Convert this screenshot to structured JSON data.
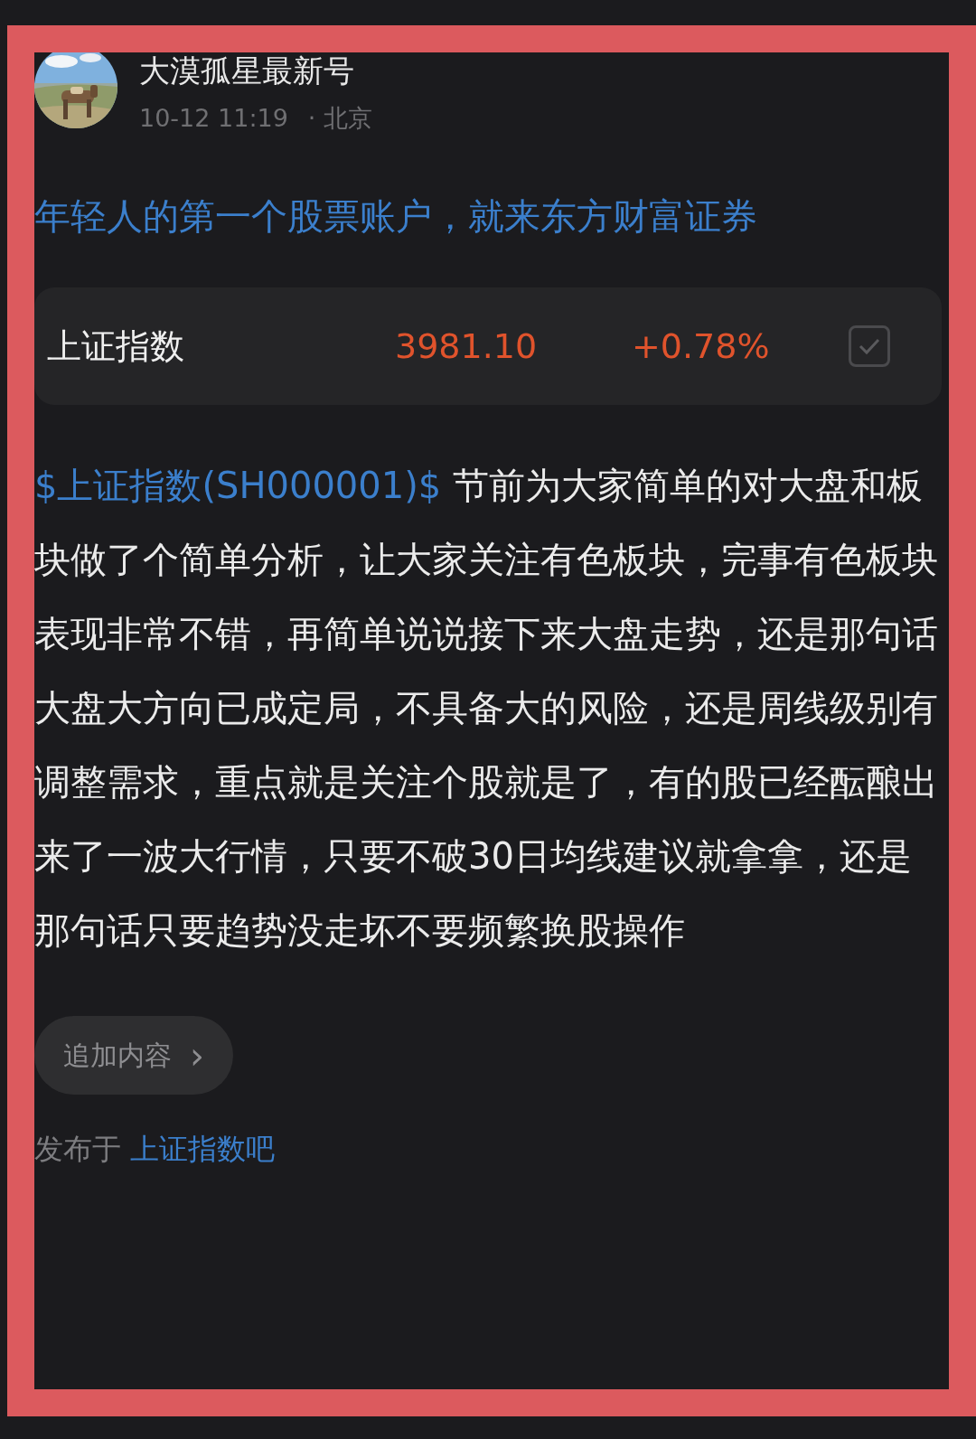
{
  "author": {
    "name": "大漠孤星最新号",
    "time": "10-12 11:19",
    "location": "· 北京"
  },
  "title": "年轻人的第一个股票账户，就来东方财富证券",
  "quote": {
    "name": "上证指数",
    "price": "3981.10",
    "change": "+0.78%",
    "watched": true
  },
  "body": {
    "tag": "$上证指数(SH000001)$",
    "text": " 节前为大家简单的对大盘和板块做了个简单分析，让大家关注有色板块，完事有色板块表现非常不错，再简单说说接下来大盘走势，还是那句话大盘大方向已成定局，不具备大的风险，还是周线级别有调整需求，重点就是关注个股就是了，有的股已经酝酿出来了一波大行情，只要不破30日均线建议就拿拿，还是那句话只要趋势没走坏不要频繁换股操作"
  },
  "append_button": {
    "label": "追加内容",
    "chevron": "›"
  },
  "footer": {
    "prefix": "发布于",
    "forum": "上证指数吧"
  }
}
